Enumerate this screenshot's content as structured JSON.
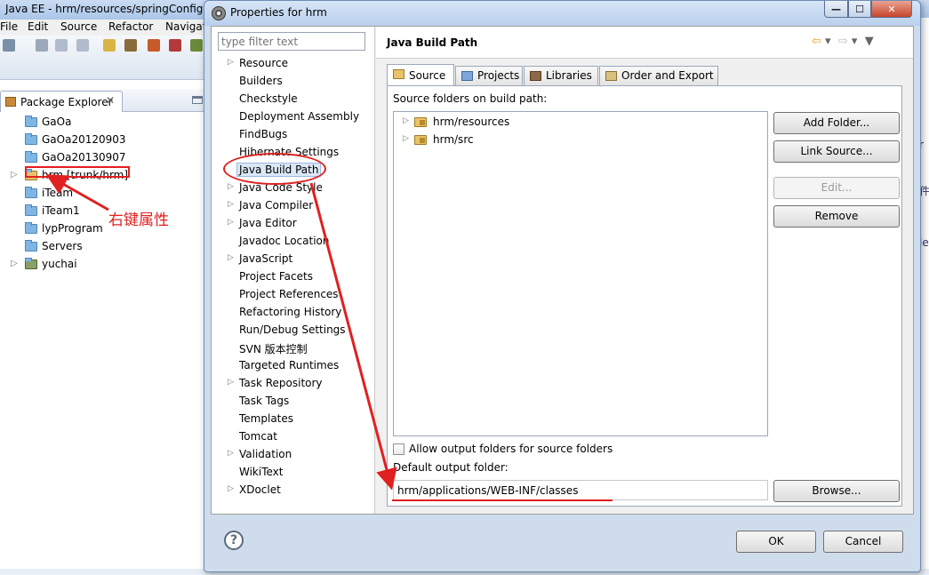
{
  "background_window": {
    "title": "Java EE - hrm/resources/springConfig",
    "menu": [
      "File",
      "Edit",
      "Source",
      "Refactor",
      "Navigat"
    ],
    "package_explorer": {
      "tab_label": "Package Explorer",
      "close_glyph": "✕",
      "items": [
        {
          "label": "GaOa",
          "expandable": false
        },
        {
          "label": "GaOa20120903",
          "expandable": false
        },
        {
          "label": "GaOa20130907",
          "expandable": false
        },
        {
          "label": "hrm [trunk/hrm]",
          "expandable": true
        },
        {
          "label": "iTeam",
          "expandable": false
        },
        {
          "label": "iTeam1",
          "expandable": false
        },
        {
          "label": "lypProgram",
          "expandable": false
        },
        {
          "label": "Servers",
          "expandable": false
        },
        {
          "label": "yuchai",
          "expandable": true
        }
      ]
    },
    "right_edge_glyphs": [
      "r",
      "件",
      "le"
    ]
  },
  "annotation": {
    "text": "右键属性",
    "color": "#e02020"
  },
  "dialog": {
    "title": "Properties for hrm",
    "window_buttons": {
      "minimize": "—",
      "maximize": "☐",
      "close": "✕"
    },
    "filter_placeholder": "type filter text",
    "nav_items": [
      {
        "label": "Resource",
        "expandable": true
      },
      {
        "label": "Builders",
        "expandable": false
      },
      {
        "label": "Checkstyle",
        "expandable": false
      },
      {
        "label": "Deployment Assembly",
        "expandable": false
      },
      {
        "label": "FindBugs",
        "expandable": false
      },
      {
        "label": "Hibernate Settings",
        "expandable": false
      },
      {
        "label": "Java Build Path",
        "expandable": false,
        "selected": true
      },
      {
        "label": "Java Code Style",
        "expandable": true
      },
      {
        "label": "Java Compiler",
        "expandable": true
      },
      {
        "label": "Java Editor",
        "expandable": true
      },
      {
        "label": "Javadoc Location",
        "expandable": false
      },
      {
        "label": "JavaScript",
        "expandable": true
      },
      {
        "label": "Project Facets",
        "expandable": false
      },
      {
        "label": "Project References",
        "expandable": false
      },
      {
        "label": "Refactoring History",
        "expandable": false
      },
      {
        "label": "Run/Debug Settings",
        "expandable": false
      },
      {
        "label": "SVN 版本控制",
        "expandable": false
      },
      {
        "label": "Targeted Runtimes",
        "expandable": false
      },
      {
        "label": "Task Repository",
        "expandable": true
      },
      {
        "label": "Task Tags",
        "expandable": false
      },
      {
        "label": "Templates",
        "expandable": false
      },
      {
        "label": "Tomcat",
        "expandable": false
      },
      {
        "label": "Validation",
        "expandable": true
      },
      {
        "label": "WikiText",
        "expandable": false
      },
      {
        "label": "XDoclet",
        "expandable": true
      }
    ],
    "page_title": "Java Build Path",
    "tabs": [
      {
        "label": "Source",
        "active": true
      },
      {
        "label": "Projects",
        "active": false
      },
      {
        "label": "Libraries",
        "active": false
      },
      {
        "label": "Order and Export",
        "active": false
      }
    ],
    "source_folders_label": "Source folders on build path:",
    "source_folders": [
      "hrm/resources",
      "hrm/src"
    ],
    "buttons": {
      "add_folder": "Add Folder...",
      "link_source": "Link Source...",
      "edit": "Edit...",
      "remove": "Remove",
      "browse": "Browse...",
      "ok": "OK",
      "cancel": "Cancel"
    },
    "allow_output_label": "Allow output folders for source folders",
    "allow_output_checked": false,
    "default_output_label": "Default output folder:",
    "default_output_value": "hrm/applications/WEB-INF/classes",
    "help_glyph": "?"
  }
}
